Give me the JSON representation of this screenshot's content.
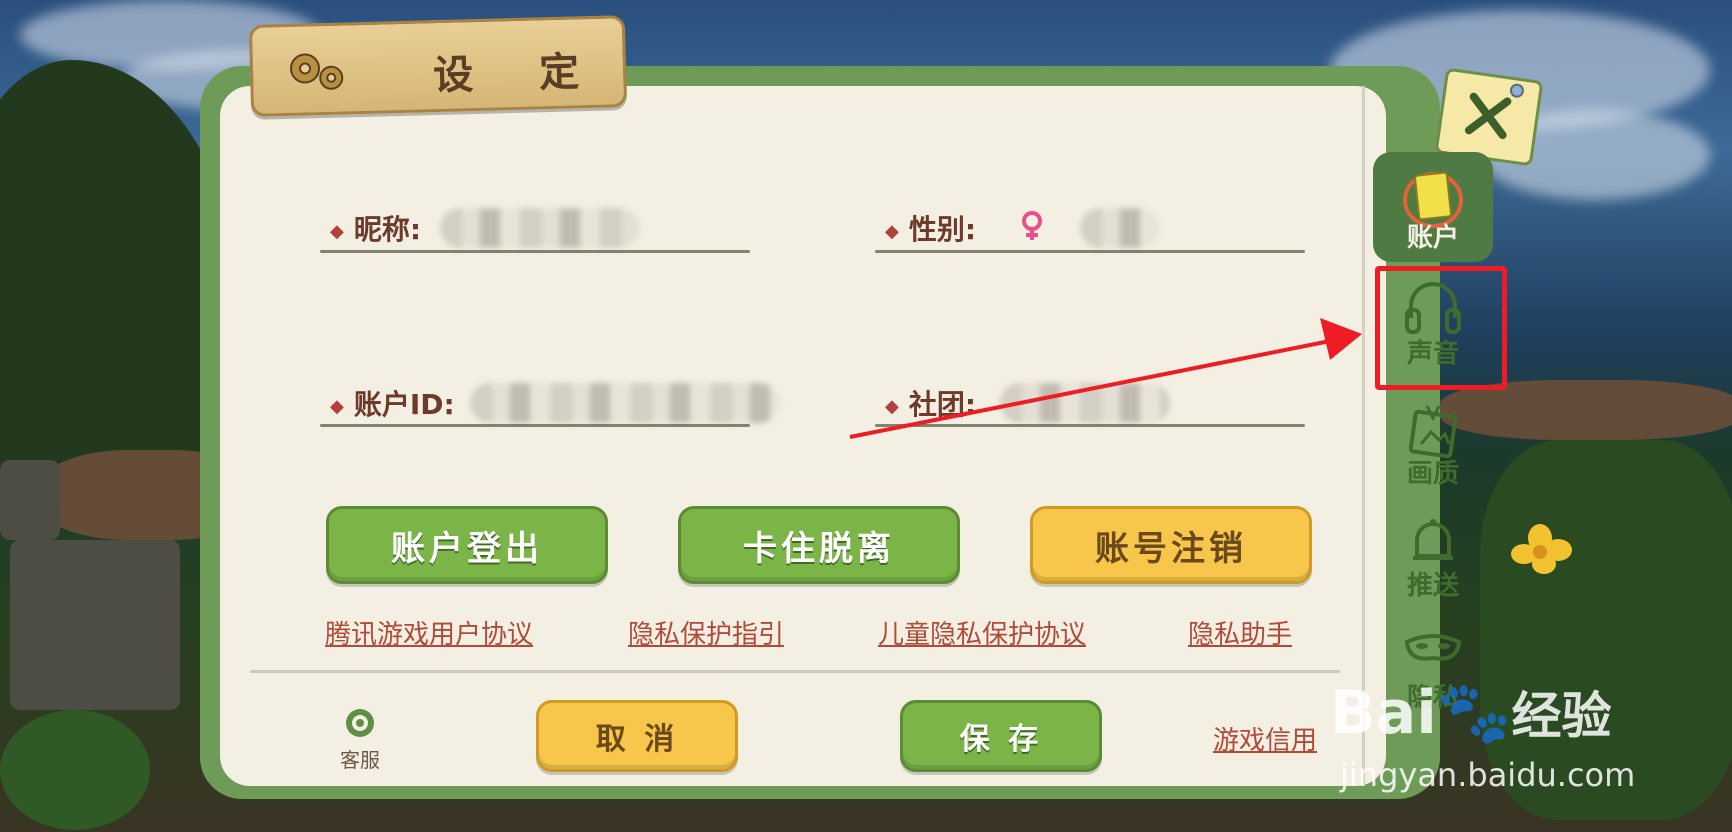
{
  "dialog": {
    "title": "设 定",
    "fields": {
      "nickname_label": "昵称:",
      "gender_label": "性别:",
      "account_id_label": "账户ID:",
      "club_label": "社团:"
    },
    "buttons": {
      "logout": "账户登出",
      "unstuck": "卡住脱离",
      "cancel_account": "账号注销",
      "cancel": "取 消",
      "save": "保 存"
    },
    "links": [
      "腾讯游戏用户协议",
      "隐私保护指引",
      "儿童隐私保护协议",
      "隐私助手"
    ],
    "bottom": {
      "support_label": "客服",
      "credit_link": "游戏信用"
    }
  },
  "sidebar": {
    "tabs": [
      {
        "label": "账户",
        "icon": "account-card-icon",
        "active": true
      },
      {
        "label": "声音",
        "icon": "headphones-icon",
        "active": false
      },
      {
        "label": "画质",
        "icon": "picture-icon",
        "active": false
      },
      {
        "label": "推送",
        "icon": "bell-icon",
        "active": false
      },
      {
        "label": "隐私",
        "icon": "mask-icon",
        "active": false
      }
    ]
  },
  "annotation": {
    "highlight_color": "#ee1c24"
  },
  "watermark": {
    "brand": "Bai",
    "brand_suffix": "经验",
    "url": "jingyan.baidu.com"
  },
  "colors": {
    "panel_green": "#6e9b57",
    "panel_cream": "#f3efe2",
    "button_green": "#7bb548",
    "button_yellow": "#f8c64a",
    "link_red": "#b24a3a"
  }
}
